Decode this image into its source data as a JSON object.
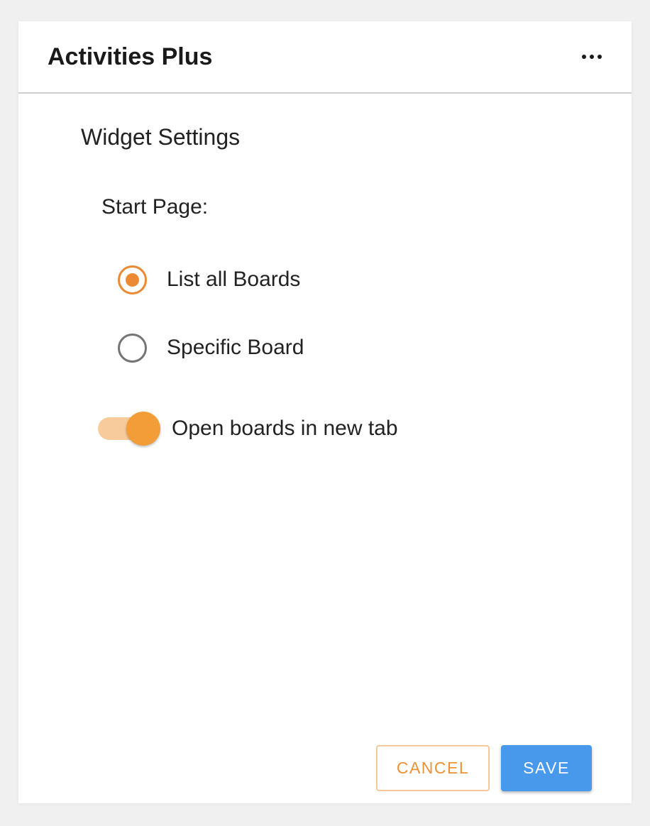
{
  "header": {
    "title": "Activities Plus",
    "more_icon": "more-horizontal-icon"
  },
  "settings": {
    "section_title": "Widget Settings",
    "start_page_label": "Start Page:",
    "start_page_options": [
      {
        "label": "List all Boards",
        "selected": true
      },
      {
        "label": "Specific Board",
        "selected": false
      }
    ],
    "open_in_new_tab": {
      "label": "Open boards in new tab",
      "enabled": true
    }
  },
  "footer": {
    "cancel_label": "CANCEL",
    "save_label": "SAVE"
  },
  "colors": {
    "accent_orange": "#ec8a34",
    "save_blue": "#4898ec",
    "toggle_track": "#f7cb9b",
    "toggle_thumb": "#f29d38"
  }
}
